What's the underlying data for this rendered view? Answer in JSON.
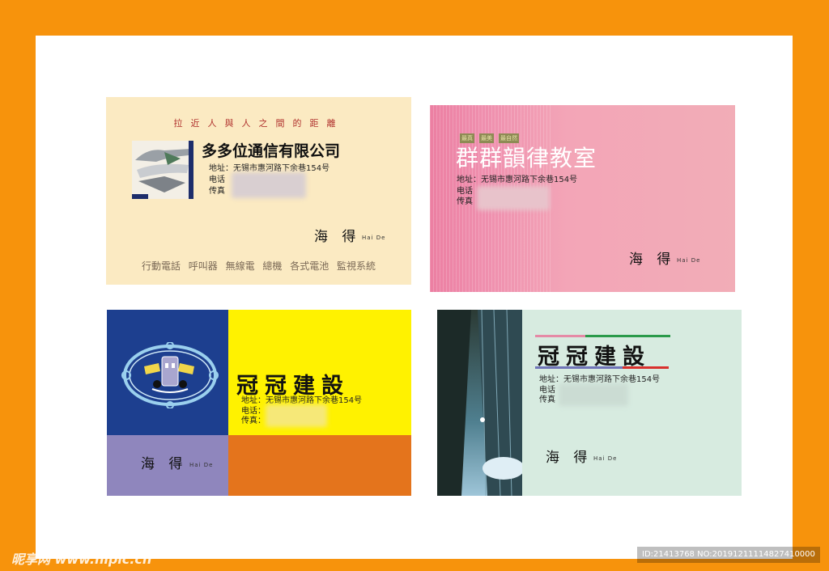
{
  "card1": {
    "slogan": "拉近人與人之間的距離",
    "company": "多多位通信有限公司",
    "address": "地址：无锡市惠河路下余巷154号",
    "phone_label": "电话",
    "fax_label": "传真",
    "person": "海 得",
    "person_en": "Hai De",
    "services": "行動電話  呼叫器  無線電  總機  各式電池  監視系統"
  },
  "card2": {
    "tags": [
      "最真",
      "最美",
      "最自然"
    ],
    "name": "群群韻律教室",
    "address": "地址：无锡市惠河路下余巷154号",
    "phone_label": "电话",
    "fax_label": "传真",
    "person": "海 得",
    "person_en": "Hai De"
  },
  "card3": {
    "name": "冠冠建設",
    "address": "地址：无锡市惠河路下余巷154号",
    "phone_label": "电话：",
    "fax_label": "传真：",
    "person": "海 得",
    "person_en": "Hai De"
  },
  "card4": {
    "name": "冠冠建設",
    "address": "地址：无锡市惠河路下余巷154号",
    "phone_label": "电话",
    "fax_label": "传真",
    "person": "海 得",
    "person_en": "Hai De"
  },
  "watermark": {
    "site": "昵享网 www.nipic.cn",
    "id": "ID:21413768 NO:20191211114827410000"
  },
  "colors": {
    "frame": "#f7930c",
    "card1_bg": "#fbeac2",
    "card2_bg": "#f2adb7",
    "card3_blue": "#1d3f8f",
    "card3_yellow": "#fff200",
    "card3_purple": "#8f86bd",
    "card3_orange": "#e4741c",
    "card4_bg": "#d7ebe0"
  }
}
